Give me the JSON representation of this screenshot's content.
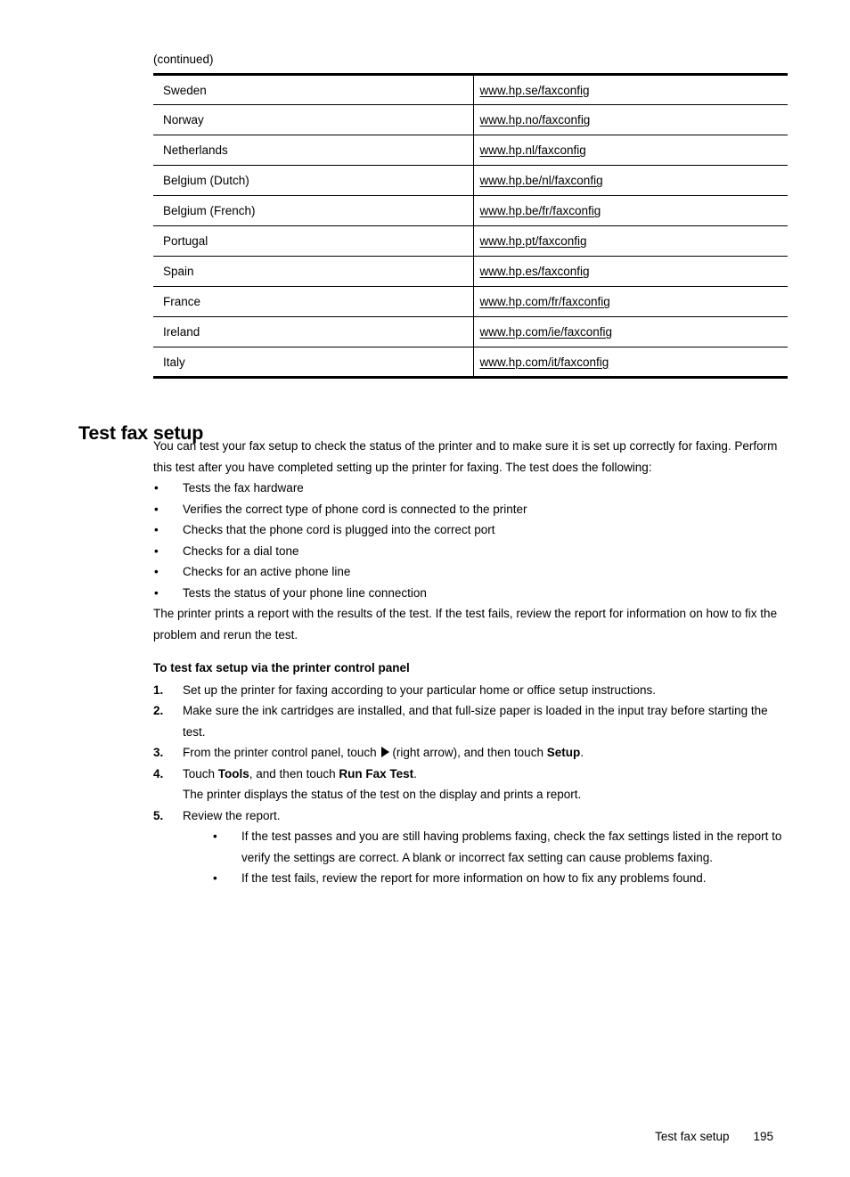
{
  "table": {
    "continued_label": "(continued)",
    "rows": [
      {
        "country": "Sweden",
        "url": "www.hp.se/faxconfig"
      },
      {
        "country": "Norway",
        "url": "www.hp.no/faxconfig"
      },
      {
        "country": "Netherlands",
        "url": "www.hp.nl/faxconfig"
      },
      {
        "country": "Belgium (Dutch)",
        "url": "www.hp.be/nl/faxconfig"
      },
      {
        "country": "Belgium (French)",
        "url": "www.hp.be/fr/faxconfig"
      },
      {
        "country": "Portugal",
        "url": "www.hp.pt/faxconfig"
      },
      {
        "country": "Spain",
        "url": "www.hp.es/faxconfig"
      },
      {
        "country": "France",
        "url": "www.hp.com/fr/faxconfig"
      },
      {
        "country": "Ireland",
        "url": "www.hp.com/ie/faxconfig"
      },
      {
        "country": "Italy",
        "url": "www.hp.com/it/faxconfig"
      }
    ]
  },
  "section": {
    "heading": "Test fax setup",
    "intro": "You can test your fax setup to check the status of the printer and to make sure it is set up correctly for faxing. Perform this test after you have completed setting up the printer for faxing. The test does the following:",
    "bullets": [
      "Tests the fax hardware",
      "Verifies the correct type of phone cord is connected to the printer",
      "Checks that the phone cord is plugged into the correct port",
      "Checks for a dial tone",
      "Checks for an active phone line",
      "Tests the status of your phone line connection"
    ],
    "after_bullets": "The printer prints a report with the results of the test. If the test fails, review the report for information on how to fix the problem and rerun the test.",
    "procedure_heading": "To test fax setup via the printer control panel",
    "steps": {
      "one": {
        "num": "1.",
        "text": "Set up the printer for faxing according to your particular home or office setup instructions."
      },
      "two": {
        "num": "2.",
        "text": "Make sure the ink cartridges are installed, and that full-size paper is loaded in the input tray before starting the test."
      },
      "three": {
        "num": "3.",
        "text_before_icon": "From the printer control panel, touch ",
        "icon": "right-arrow-icon",
        "text_after_icon": "(right arrow), and then touch ",
        "bold_term": "Setup",
        "text_end": "."
      },
      "four": {
        "num": "4.",
        "text_start": "Touch ",
        "bold_term_1": "Tools",
        "text_mid": ", and then touch ",
        "bold_term_2": "Run Fax Test",
        "text_end": ".",
        "note": "The printer displays the status of the test on the display and prints a report."
      },
      "five": {
        "num": "5.",
        "text": "Review the report.",
        "subbullets": [
          "If the test passes and you are still having problems faxing, check the fax settings listed in the report to verify the settings are correct. A blank or incorrect fax setting can cause problems faxing.",
          "If the test fails, review the report for more information on how to fix any problems found."
        ]
      }
    }
  },
  "footer": {
    "title": "Test fax setup",
    "page_number": "195"
  },
  "bullet_char": "•"
}
